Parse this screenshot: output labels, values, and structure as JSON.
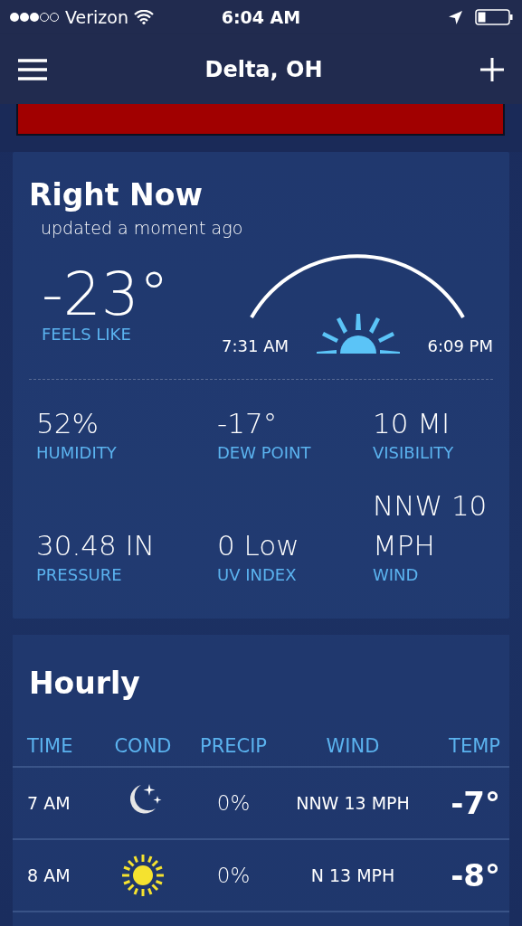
{
  "status_bar": {
    "carrier": "Verizon",
    "time": "6:04 AM"
  },
  "nav": {
    "title": "Delta, OH"
  },
  "right_now": {
    "title": "Right Now",
    "updated": "updated a moment ago",
    "feels_like": {
      "value": "-23°",
      "label": "FEELS LIKE"
    },
    "sunrise": "7:31 AM",
    "sunset": "6:09 PM",
    "stats": [
      {
        "value": "52%",
        "label": "HUMIDITY"
      },
      {
        "value": "-17°",
        "label": "DEW POINT"
      },
      {
        "value": "10 MI",
        "label": "VISIBILITY"
      },
      {
        "value": "30.48 IN",
        "label": "PRESSURE"
      },
      {
        "value": "0 Low",
        "label": "UV INDEX"
      },
      {
        "value": "NNW 10 MPH",
        "label": "WIND"
      }
    ]
  },
  "hourly": {
    "title": "Hourly",
    "columns": [
      "TIME",
      "COND",
      "PRECIP",
      "WIND",
      "TEMP"
    ],
    "rows": [
      {
        "time": "7 AM",
        "kind": "moon",
        "precip": "0%",
        "wind": "NNW 13 MPH",
        "temp": "-7°"
      },
      {
        "time": "8 AM",
        "kind": "sun",
        "precip": "0%",
        "wind": "N 13 MPH",
        "temp": "-8°"
      }
    ]
  }
}
